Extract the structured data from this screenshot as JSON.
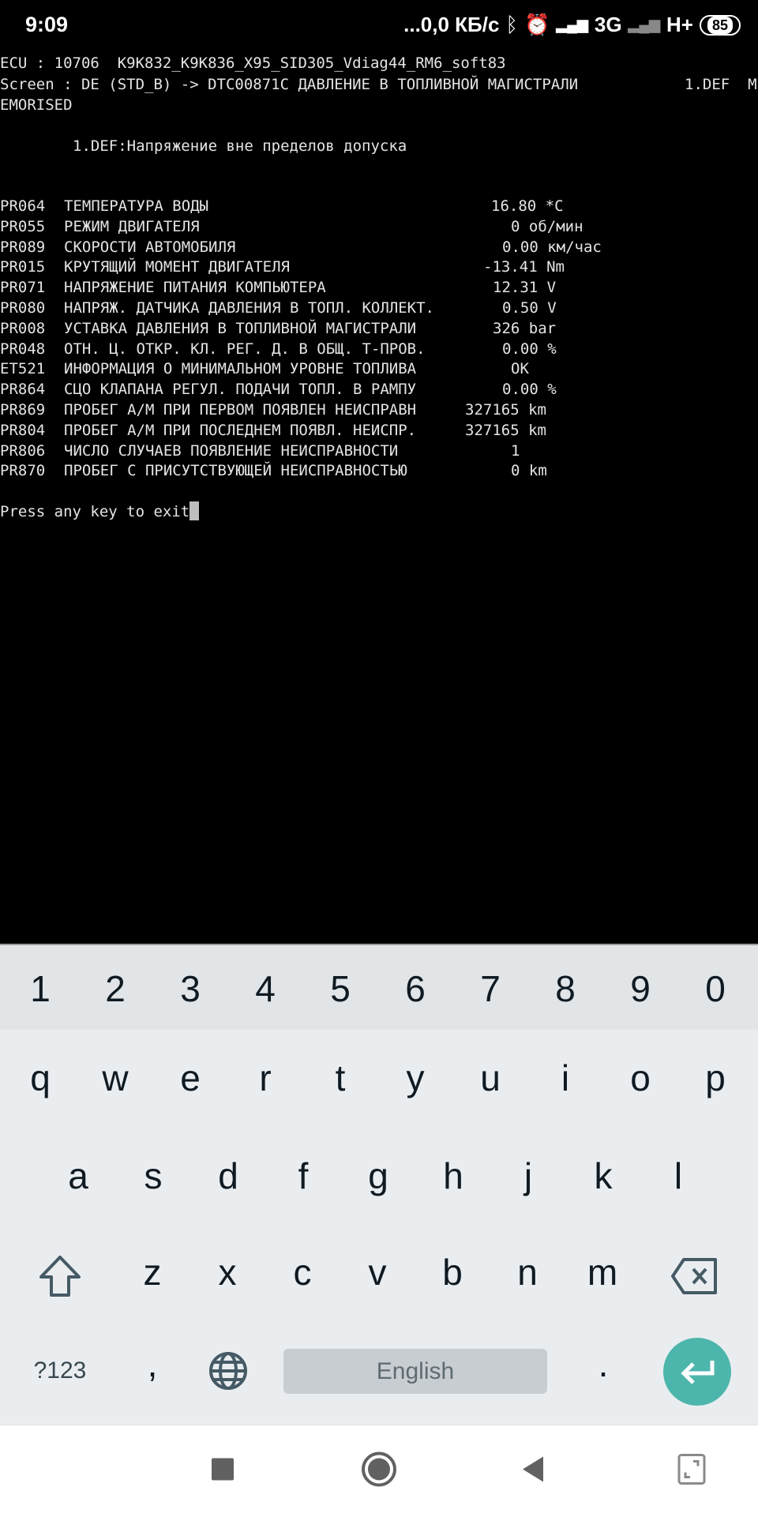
{
  "status_bar": {
    "time": "9:09",
    "net_speed": "...0,0 КБ/с",
    "network1": "3G",
    "network2": "H+",
    "battery": "85"
  },
  "terminal": {
    "ecu_line": "ECU : 10706  K9K832_K9K836_X95_SID305_Vdiag44_RM6_soft83",
    "screen_line": "Screen : DE (STD_B) -> DTC00871C ДАВЛЕНИЕ В ТОПЛИВНОЙ МАГИСТРАЛИ",
    "screen_line_tail": "1.DEF  M",
    "screen_line_wrap": "EMORISED",
    "def_line": "1.DEF:Напряжение вне пределов допуска",
    "rows": [
      {
        "code": "PR064",
        "label": "ТЕМПЕРАТУРА ВОДЫ",
        "value": "16.80 *C"
      },
      {
        "code": "PR055",
        "label": "РЕЖИМ ДВИГАТЕЛЯ",
        "value": "0 об/мин"
      },
      {
        "code": "PR089",
        "label": "СКОРОСТИ АВТОМОБИЛЯ",
        "value": "0.00 км/час"
      },
      {
        "code": "PR015",
        "label": "КРУТЯЩИЙ МОМЕНТ ДВИГАТЕЛЯ",
        "value": "-13.41 Nm"
      },
      {
        "code": "PR071",
        "label": "НАПРЯЖЕНИЕ ПИТАНИЯ КОМПЬЮТЕРА",
        "value": "12.31 V"
      },
      {
        "code": "PR080",
        "label": "НАПРЯЖ. ДАТЧИКА ДАВЛЕНИЯ В ТОПЛ. КОЛЛЕКТ.",
        "value": "0.50 V"
      },
      {
        "code": "PR008",
        "label": "УСТАВКА ДАВЛЕНИЯ В ТОПЛИВНОЙ МАГИСТРАЛИ",
        "value": "326 bar"
      },
      {
        "code": "PR048",
        "label": "ОТН. Ц. ОТКР. КЛ. РЕГ. Д. В ОБЩ. Т-ПРОВ.",
        "value": "0.00 %"
      },
      {
        "code": "ET521",
        "label": "ИНФОРМАЦИЯ О МИНИМАЛЬНОМ УРОВНЕ ТОПЛИВА",
        "value": "OK"
      },
      {
        "code": "PR864",
        "label": "СЦО КЛАПАНА РЕГУЛ. ПОДАЧИ ТОПЛ. В РАМПУ",
        "value": "0.00 %"
      },
      {
        "code": "PR869",
        "label": "ПРОБЕГ А/М ПРИ ПЕРВОМ ПОЯВЛЕН НЕИСПРАВН",
        "value": "327165 km"
      },
      {
        "code": "PR804",
        "label": "ПРОБЕГ А/М ПРИ ПОСЛЕДНЕМ ПОЯВЛ. НЕИСПР.",
        "value": "327165 km"
      },
      {
        "code": "PR806",
        "label": "ЧИСЛО СЛУЧАЕВ ПОЯВЛЕНИЕ НЕИСПРАВНОСТИ",
        "value": "1"
      },
      {
        "code": "PR870",
        "label": "ПРОБЕГ С ПРИСУТСТВУЮЩЕЙ НЕИСПРАВНОСТЬЮ",
        "value": "0 km"
      }
    ],
    "prompt": "Press any key to exit"
  },
  "keyboard": {
    "number_row": [
      "1",
      "2",
      "3",
      "4",
      "5",
      "6",
      "7",
      "8",
      "9",
      "0"
    ],
    "row1": [
      "q",
      "w",
      "e",
      "r",
      "t",
      "y",
      "u",
      "i",
      "o",
      "p"
    ],
    "row2": [
      "a",
      "s",
      "d",
      "f",
      "g",
      "h",
      "j",
      "k",
      "l"
    ],
    "row3": [
      "z",
      "x",
      "c",
      "v",
      "b",
      "n",
      "m"
    ],
    "symbols_label": "?123",
    "comma": ",",
    "period": ".",
    "space_label": "English",
    "accent_color": "#4db6ac"
  },
  "icons": {
    "shift": "shift-icon",
    "backspace": "backspace-icon",
    "globe": "globe-icon",
    "enter": "enter-icon",
    "recents": "square-icon",
    "home": "circle-icon",
    "back": "triangle-back-icon",
    "rotate": "rotate-icon"
  }
}
